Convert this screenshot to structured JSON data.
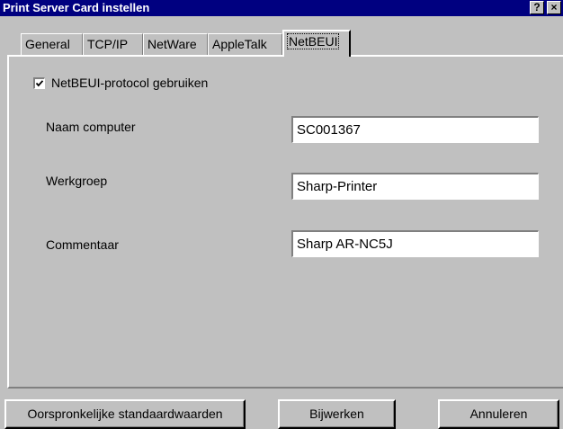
{
  "window": {
    "title": "Print Server Card instellen",
    "help_glyph": "?",
    "close_glyph": "×"
  },
  "tabs": [
    {
      "label": "General",
      "active": false
    },
    {
      "label": "TCP/IP",
      "active": false
    },
    {
      "label": "NetWare",
      "active": false
    },
    {
      "label": "AppleTalk",
      "active": false
    },
    {
      "label": "NetBEUI",
      "active": true
    }
  ],
  "netbeui": {
    "enable_checkbox": {
      "label": "NetBEUI-protocol gebruiken",
      "checked": true
    },
    "computer_name": {
      "label": "Naam computer",
      "value": "SC001367"
    },
    "workgroup": {
      "label": "Werkgroep",
      "value": "Sharp-Printer"
    },
    "comment": {
      "label": "Commentaar",
      "value": "Sharp AR-NC5J"
    }
  },
  "buttons": {
    "defaults": "Oorspronkelijke standaardwaarden",
    "update": "Bijwerken",
    "cancel": "Annuleren"
  },
  "colors": {
    "titlebar": "#000080",
    "face": "#c0c0c0"
  }
}
